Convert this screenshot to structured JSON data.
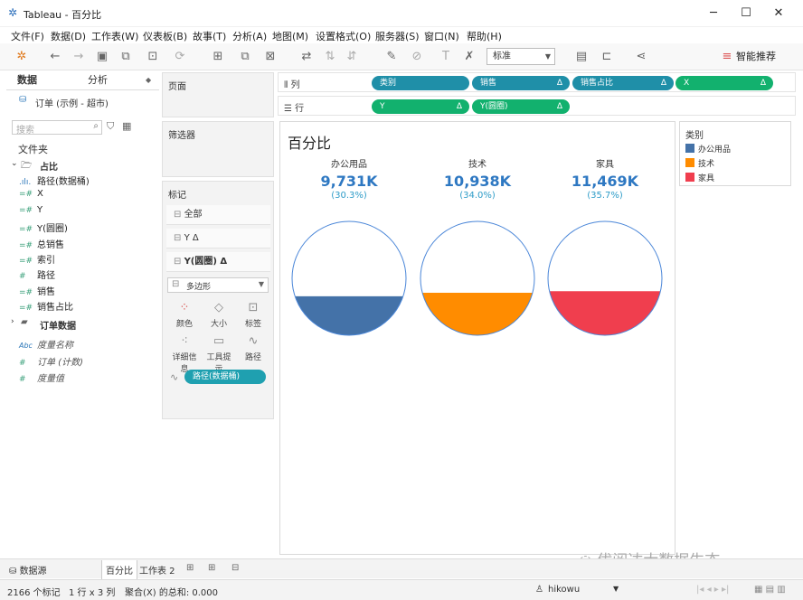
{
  "window": {
    "app_icon": "tableau-logo-icon",
    "title": "Tableau - 百分比",
    "minimize": "─",
    "maximize": "☐",
    "close": "✕"
  },
  "menu": [
    "文件(F)",
    "数据(D)",
    "工作表(W)",
    "仪表板(B)",
    "故事(T)",
    "分析(A)",
    "地图(M)",
    "设置格式(O)",
    "服务器(S)",
    "窗口(N)",
    "帮助(H)"
  ],
  "toolbar": {
    "fit_select": "标准",
    "smart_recommend": "智能推荐"
  },
  "left": {
    "tab_data": "数据",
    "tab_analysis": "分析",
    "datasource": "订单 (示例 - 超市)",
    "search_placeholder": "搜索",
    "folders_label": "文件夹",
    "folder_name": "占比",
    "folder_fields": [
      {
        "icon": ".ılı.",
        "name": "路径(数据桶)"
      },
      {
        "icon": "=#",
        "name": "X"
      },
      {
        "icon": "=#",
        "name": "Y"
      },
      {
        "icon": "=#",
        "name": "Y(圆圈)"
      },
      {
        "icon": "=#",
        "name": "总销售"
      },
      {
        "icon": "=#",
        "name": "索引"
      },
      {
        "icon": "#",
        "name": "路径"
      },
      {
        "icon": "=#",
        "name": "销售"
      },
      {
        "icon": "=#",
        "name": "销售占比"
      }
    ],
    "order_folder": "订单数据",
    "measure_names": "度量名称",
    "order_count": "订单 (计数)",
    "measure_values": "度量值"
  },
  "cards": {
    "pages": "页面",
    "filters": "筛选器",
    "marks": "标记",
    "mark_all": "全部",
    "mark_y": "Y Δ",
    "mark_ycircle": "Y(圆圈) Δ",
    "mark_type": "多边形",
    "btn_color": "颜色",
    "btn_size": "大小",
    "btn_label": "标签",
    "btn_detail": "详细信息",
    "btn_tooltip": "工具提示",
    "btn_path": "路径",
    "path_pill": "路径(数据桶)"
  },
  "shelves": {
    "columns_label": "列",
    "rows_label": "行",
    "columns": [
      {
        "label": "类别",
        "delta": ""
      },
      {
        "label": "销售",
        "delta": "Δ"
      },
      {
        "label": "销售占比",
        "delta": "Δ"
      },
      {
        "label": "X",
        "delta": "Δ"
      }
    ],
    "rows": [
      {
        "label": "Y",
        "delta": "Δ"
      },
      {
        "label": "Y(圆圈)",
        "delta": "Δ"
      }
    ]
  },
  "view": {
    "title": "百分比"
  },
  "chart_data": {
    "type": "pie",
    "title": "百分比",
    "categories": [
      "办公用品",
      "技术",
      "家具"
    ],
    "value_labels": [
      "9,731K",
      "10,938K",
      "11,469K"
    ],
    "values": [
      9731,
      10938,
      11469
    ],
    "percent_labels": [
      "(30.3%)",
      "(34.0%)",
      "(35.7%)"
    ],
    "percent": [
      0.303,
      0.34,
      0.357
    ],
    "colors": [
      "#4472a8",
      "#ff8c00",
      "#f03e4e"
    ],
    "legend_title": "类别",
    "legend_position": "right"
  },
  "tabs": {
    "datasource": "数据源",
    "sheet1": "百分比",
    "sheet2": "工作表 2"
  },
  "status": {
    "marks": "2166 个标记",
    "rowscols": "1 行 x 3 列",
    "sum": "聚合(X) 的总和: 0.000",
    "user": "hikowu"
  },
  "watermark": "优阅达大数据生态"
}
